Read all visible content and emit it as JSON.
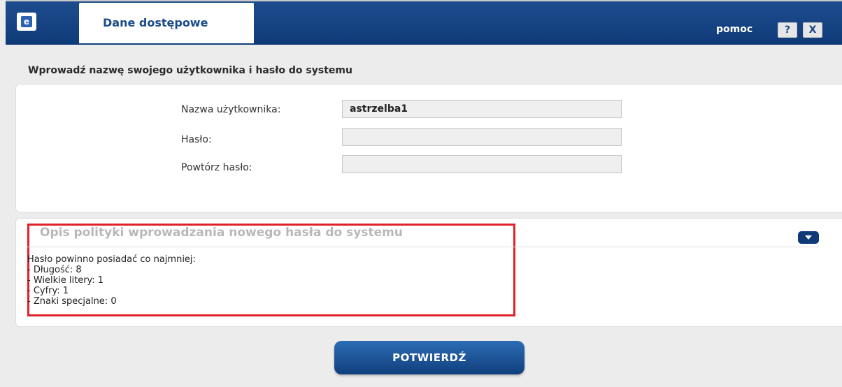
{
  "window": {
    "tab_title": "Dane dostępowe",
    "help_label": "pomoc",
    "help_button": "?",
    "close_button": "X"
  },
  "form": {
    "instruction": "Wprowadź nazwę swojego użytkownika i hasło do systemu",
    "username_label": "Nazwa użytkownika:",
    "username_value": "astrzelba1",
    "password_label": "Hasło:",
    "password_value": "",
    "repeat_label": "Powtórz hasło:",
    "repeat_value": ""
  },
  "policy": {
    "title": "Opis polityki wprowadzania nowego hasła do systemu",
    "lines": [
      "Hasło powinno posiadać co najmniej:",
      "- Długość: 8",
      "- Wielkie litery: 1",
      "- Cyfry: 1",
      "- Znaki specjalne: 0"
    ]
  },
  "confirm_label": "POTWIERDŹ",
  "colors": {
    "header": "#0f3a78",
    "highlight": "#e0202a",
    "tab": "#ffffff"
  },
  "icons": {
    "logo": "app-logo-icon",
    "collapse": "chevron-down-icon"
  }
}
